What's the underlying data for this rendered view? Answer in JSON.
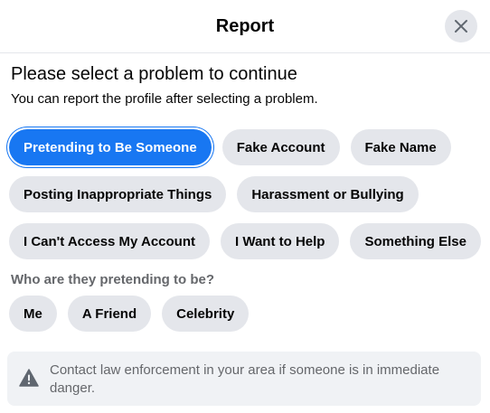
{
  "header": {
    "title": "Report",
    "close_icon": "close-icon"
  },
  "main": {
    "heading": "Please select a problem to continue",
    "subheading": "You can report the profile after selecting a problem.",
    "problems": [
      "Pretending to Be Someone",
      "Fake Account",
      "Fake Name",
      "Posting Inappropriate Things",
      "Harassment or Bullying",
      "I Can't Access My Account",
      "I Want to Help",
      "Something Else"
    ],
    "selected_problem": "Pretending to Be Someone",
    "followup": {
      "question": "Who are they pretending to be?",
      "options": [
        "Me",
        "A Friend",
        "Celebrity"
      ]
    }
  },
  "notice": {
    "icon": "warning-icon",
    "text": "Contact law enforcement in your area if someone is in immediate danger."
  },
  "colors": {
    "accent": "#1877f2",
    "chip_bg": "#e4e6eb",
    "notice_bg": "#f0f2f5",
    "secondary_text": "#65676b"
  }
}
